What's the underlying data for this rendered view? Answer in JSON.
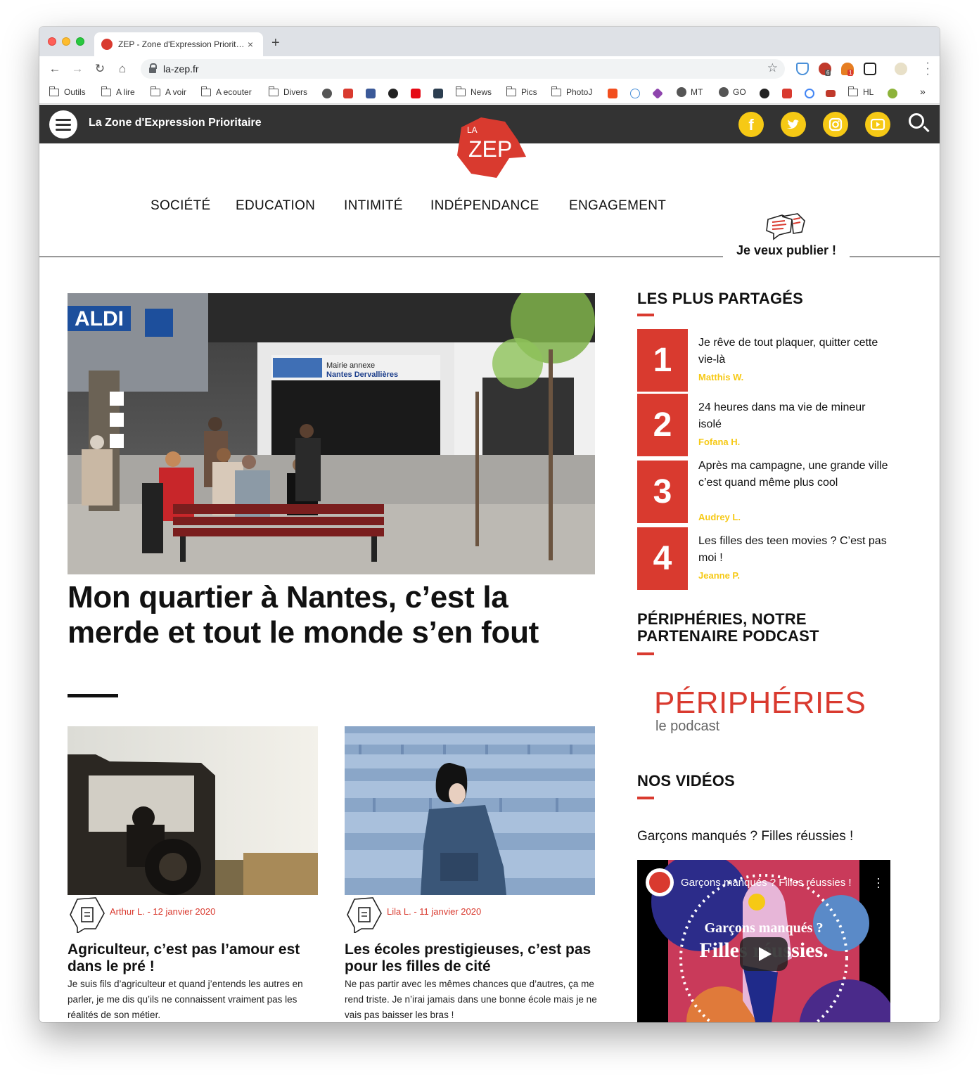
{
  "browser": {
    "tab_title": "ZEP - Zone d'Expression Prioritaire",
    "tab_close": "×",
    "new_tab": "+",
    "url": "la-zep.fr",
    "bookmarks": [
      "Outils",
      "A lire",
      "A voir",
      "A ecouter",
      "Divers",
      "News",
      "Pics",
      "PhotoJ",
      "MT",
      "GO",
      "HL"
    ],
    "bookmarks_more": "»",
    "ext_badges": [
      "6",
      "1"
    ]
  },
  "site": {
    "title": "La Zone d'Expression Prioritaire",
    "logo_top": "LA",
    "logo_main": "ZEP",
    "social": [
      "f",
      "t",
      "ig",
      "yt"
    ],
    "nav": [
      "SOCIÉTÉ",
      "EDUCATION",
      "INTIMITÉ",
      "INDÉPENDANCE",
      "ENGAGEMENT"
    ],
    "publish": "Je veux publier !"
  },
  "hero": {
    "title": "Mon quartier à Nantes, c’est la merde et tout le monde s’en fout",
    "sign_line1": "Mairie annexe",
    "sign_line2": "Nantes Dervallières",
    "store_sign": "ALDI"
  },
  "cards": [
    {
      "author": "Arthur L.",
      "date": "12 janvier 2020",
      "title": "Agriculteur, c’est pas l’amour est dans le pré !",
      "excerpt": "Je suis fils d’agriculteur et quand j’entends les autres en parler, je me dis qu’ils ne connaissent vraiment pas les réalités de son métier."
    },
    {
      "author": "Lila L.",
      "date": "11 janvier 2020",
      "title": "Les écoles prestigieuses, c’est pas pour les filles de cité",
      "excerpt": "Ne pas partir avec les mêmes chances que d’autres, ça me rend triste. Je n’irai jamais dans une bonne école mais je ne vais pas baisser les bras !"
    }
  ],
  "sidebar": {
    "most_shared_heading": "LES PLUS PARTAGÉS",
    "most_shared": [
      {
        "rank": "1",
        "title": "Je rêve de tout plaquer, quitter cette vie-là",
        "author": "Matthis W."
      },
      {
        "rank": "2",
        "title": "24 heures dans ma vie de mineur isolé",
        "author": "Fofana H."
      },
      {
        "rank": "3",
        "title": "Après ma campagne, une grande ville c’est quand même plus cool",
        "author": "Audrey L."
      },
      {
        "rank": "4",
        "title": "Les filles des teen movies ? C’est pas moi !",
        "author": "Jeanne P."
      }
    ],
    "podcast_heading": "PÉRIPHÉRIES, NOTRE PARTENAIRE PODCAST",
    "podcast_logo_big": "PÉRIPHÉRIES",
    "podcast_logo_small": "le podcast",
    "videos_heading": "NOS VIDÉOS",
    "video_title": "Garçons manqués ? Filles réussies !",
    "video_player_title": "Garçons manqués ? Filles réussies !",
    "video_overlay_line1": "Garçons manqués ?",
    "video_overlay_line2": "Filles réussies."
  },
  "colors": {
    "accent": "#d93a2f",
    "social": "#f6c915",
    "topbar": "#333333"
  }
}
